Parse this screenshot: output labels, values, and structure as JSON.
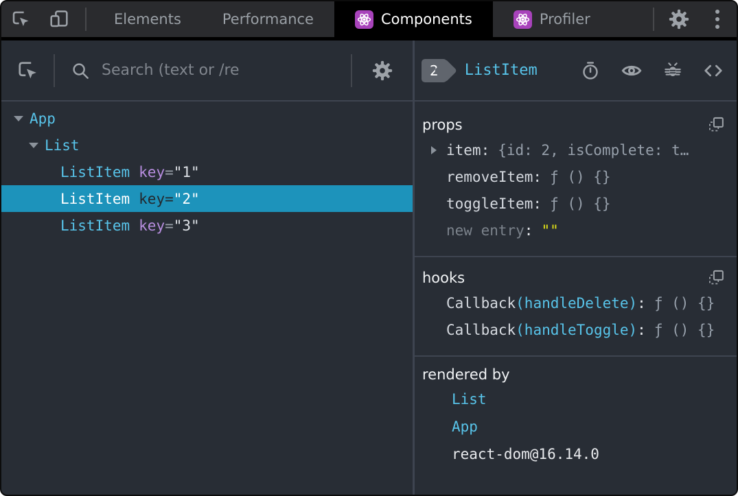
{
  "colors": {
    "accent_cyan": "#58c4ea",
    "key_purple": "#b88ee0",
    "selected_row_bg": "#1d93bb",
    "react_tile_purple": "#a843bb",
    "string_yellow": "#e5e516"
  },
  "tabbar": {
    "left_icons": [
      "inspect-element-icon",
      "device-toolbar-icon"
    ],
    "tabs": [
      {
        "label": "Elements",
        "selected": false
      },
      {
        "label": "Performance",
        "selected": false
      },
      {
        "label": "Components",
        "selected": true,
        "icon": "react-icon"
      },
      {
        "label": "Profiler",
        "selected": false,
        "icon": "react-icon"
      }
    ],
    "right_icons": [
      "settings-gear-icon",
      "kebab-menu-icon"
    ]
  },
  "left_panel": {
    "toolbar": {
      "icons": [
        "inspect-component-icon",
        "search-icon",
        "settings-gear-icon"
      ],
      "search_placeholder": "Search (text or /re"
    },
    "tree": [
      {
        "name": "App",
        "depth": 0,
        "expanded": true
      },
      {
        "name": "List",
        "depth": 1,
        "expanded": true
      },
      {
        "name": "ListItem",
        "attr": "key",
        "eq": "=",
        "value": "\"1\"",
        "depth": 2,
        "selected": false
      },
      {
        "name": "ListItem",
        "attr": "key",
        "eq": "=",
        "value": "\"2\"",
        "depth": 2,
        "selected": true
      },
      {
        "name": "ListItem",
        "attr": "key",
        "eq": "=",
        "value": "\"3\"",
        "depth": 2,
        "selected": false
      }
    ]
  },
  "right_panel": {
    "header": {
      "badge": "2",
      "title": "ListItem",
      "icons": [
        "suspense-stopwatch-icon",
        "inspect-dom-eye-icon",
        "log-to-console-bug-icon",
        "view-source-icon"
      ]
    },
    "props": {
      "title": "props",
      "rows": [
        {
          "label": "item:",
          "value": "{id: 2, isComplete: t…",
          "expandable": true
        },
        {
          "label": "removeItem:",
          "value": "ƒ () {}"
        },
        {
          "label": "toggleItem:",
          "value": "ƒ () {}"
        }
      ],
      "new_entry": {
        "label": "new entry",
        "colon": ":",
        "value": "\"\""
      }
    },
    "hooks": {
      "title": "hooks",
      "rows": [
        {
          "prefix": "Callback",
          "paren": "(handleDelete)",
          "colon": ":",
          "value": "ƒ () {}"
        },
        {
          "prefix": "Callback",
          "paren": "(handleToggle)",
          "colon": ":",
          "value": "ƒ () {}"
        }
      ]
    },
    "rendered_by": {
      "title": "rendered by",
      "items": [
        {
          "label": "List",
          "link": true
        },
        {
          "label": "App",
          "link": true
        },
        {
          "label": "react-dom@16.14.0",
          "link": false
        }
      ]
    }
  }
}
